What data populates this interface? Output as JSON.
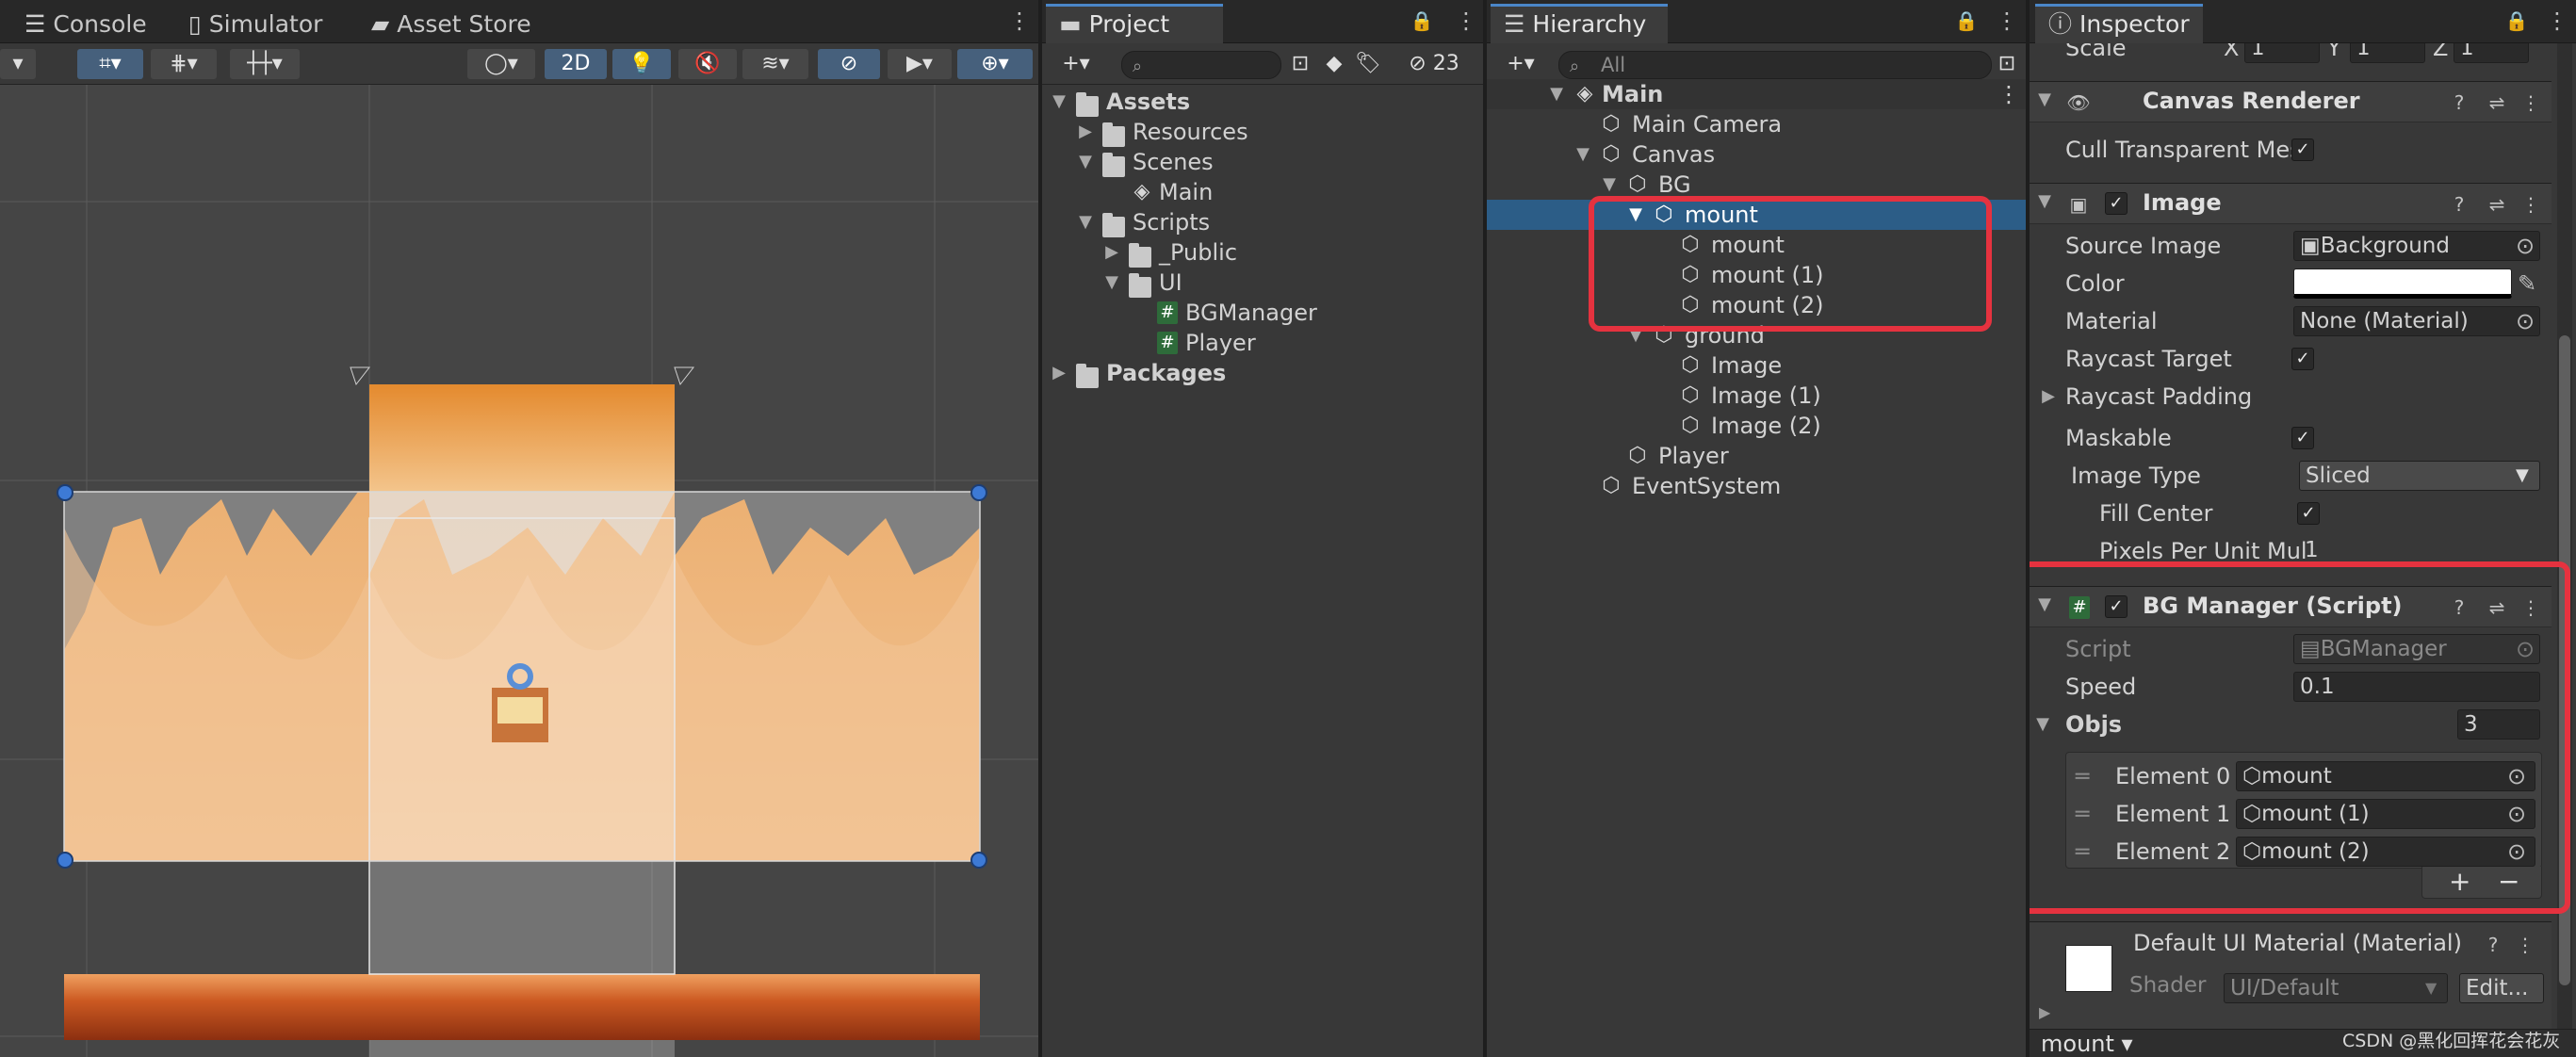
{
  "scene": {
    "tabs": {
      "console": "Console",
      "simulator": "Simulator",
      "asset_store": "Asset Store"
    },
    "toolbar": {
      "mode_2d": "2D"
    },
    "scene_colors": {
      "sand": "#f0c08e",
      "dark": "#3c3c3c",
      "sky": "#f3b466",
      "highlight": "#f6d6b0"
    }
  },
  "project": {
    "tab": "Project",
    "hidden_count": "23",
    "search_placeholder": "",
    "tree": [
      {
        "label": "Assets",
        "bold": true
      },
      {
        "label": "Resources"
      },
      {
        "label": "Scenes"
      },
      {
        "label": "Main"
      },
      {
        "label": "Scripts"
      },
      {
        "label": "_Public"
      },
      {
        "label": "UI"
      },
      {
        "label": "BGManager"
      },
      {
        "label": "Player"
      },
      {
        "label": "Packages",
        "bold": true
      }
    ]
  },
  "hierarchy": {
    "tab": "Hierarchy",
    "search_placeholder": "All",
    "items": [
      {
        "label": "Main"
      },
      {
        "label": "Main Camera"
      },
      {
        "label": "Canvas"
      },
      {
        "label": "BG"
      },
      {
        "label": "mount"
      },
      {
        "label": "mount"
      },
      {
        "label": "mount (1)"
      },
      {
        "label": "mount (2)"
      },
      {
        "label": "ground"
      },
      {
        "label": "Image"
      },
      {
        "label": "Image (1)"
      },
      {
        "label": "Image (2)"
      },
      {
        "label": "Player"
      },
      {
        "label": "EventSystem"
      }
    ]
  },
  "inspector": {
    "tab": "Inspector",
    "scale": {
      "label": "Scale",
      "x_label": "X",
      "x": "1",
      "y_label": "Y",
      "y": "1",
      "z_label": "Z",
      "z": "1"
    },
    "canvas_renderer": {
      "title": "Canvas Renderer",
      "cull_label": "Cull Transparent Mes"
    },
    "image": {
      "title": "Image",
      "source_image_label": "Source Image",
      "source_image": "Background",
      "color_label": "Color",
      "material_label": "Material",
      "material": "None (Material)",
      "raycast_target_label": "Raycast Target",
      "raycast_padding_label": "Raycast Padding",
      "maskable_label": "Maskable",
      "image_type_label": "Image Type",
      "image_type": "Sliced",
      "fill_center_label": "Fill Center",
      "ppu_label": "Pixels Per Unit Mul",
      "ppu": "1"
    },
    "bg_manager": {
      "title": "BG Manager (Script)",
      "script_label": "Script",
      "script": "BGManager",
      "speed_label": "Speed",
      "speed": "0.1",
      "objs_label": "Objs",
      "objs_count": "3",
      "elements": [
        {
          "label": "Element 0",
          "value": "mount"
        },
        {
          "label": "Element 1",
          "value": "mount (1)"
        },
        {
          "label": "Element 2",
          "value": "mount (2)"
        }
      ],
      "add": "+",
      "remove": "−"
    },
    "material": {
      "title": "Default UI Material (Material)",
      "shader_label": "Shader",
      "shader": "UI/Default",
      "edit": "Edit..."
    },
    "footer": {
      "object": "mount"
    }
  },
  "watermark": "CSDN @黑化回挥花会花灰",
  "colors": {
    "accent": "#4a86c8",
    "selection": "#2c5d87",
    "annotation": "#e5323f",
    "panel": "#383838"
  }
}
